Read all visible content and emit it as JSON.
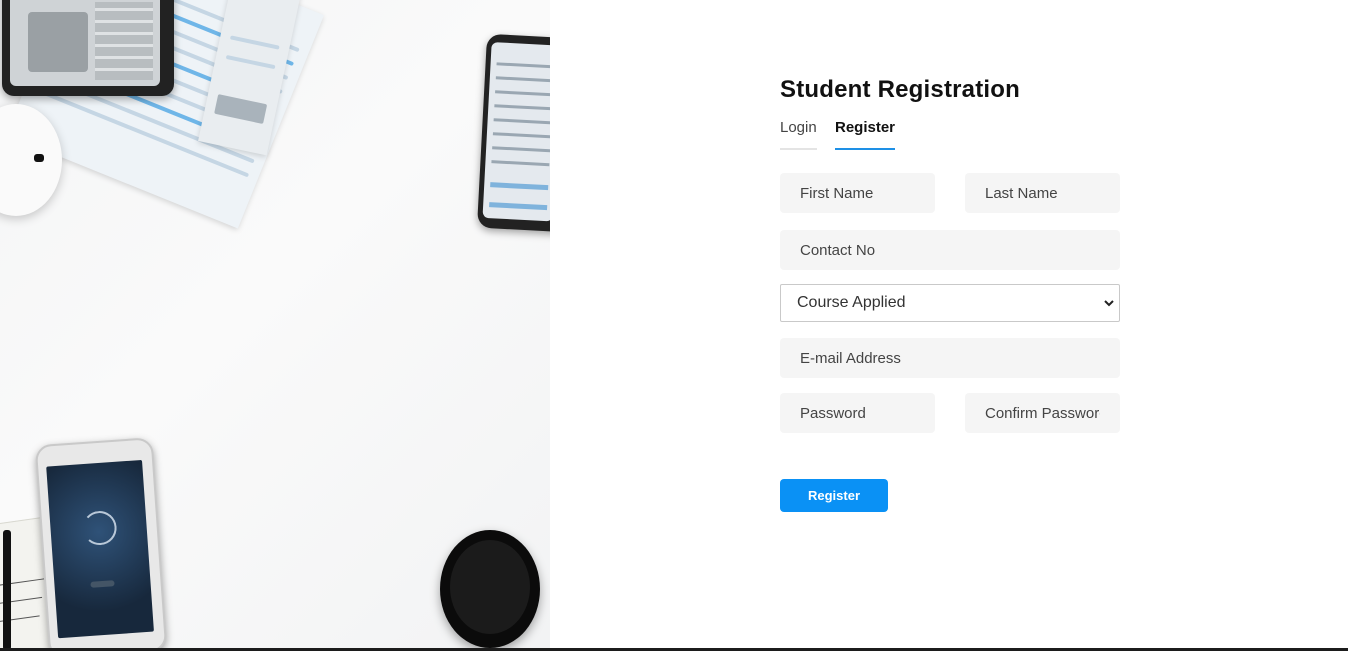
{
  "form": {
    "title": "Student Registration",
    "tabs": [
      {
        "label": "Login",
        "active": false
      },
      {
        "label": "Register",
        "active": true
      }
    ],
    "first_name": {
      "placeholder": "First Name",
      "value": ""
    },
    "last_name": {
      "placeholder": "Last Name",
      "value": ""
    },
    "contact": {
      "placeholder": "Contact No",
      "value": ""
    },
    "course": {
      "selected": "Course Applied"
    },
    "email": {
      "placeholder": "E-mail Address",
      "value": ""
    },
    "password": {
      "placeholder": "Password",
      "value": ""
    },
    "confirm_password": {
      "placeholder": "Confirm Password",
      "value": ""
    },
    "submit_label": "Register"
  },
  "colors": {
    "accent": "#0a91f5",
    "tab_underline": "#1e90e6",
    "field_bg": "#f5f5f5"
  },
  "icons": {
    "select": "chevron-down-icon"
  }
}
